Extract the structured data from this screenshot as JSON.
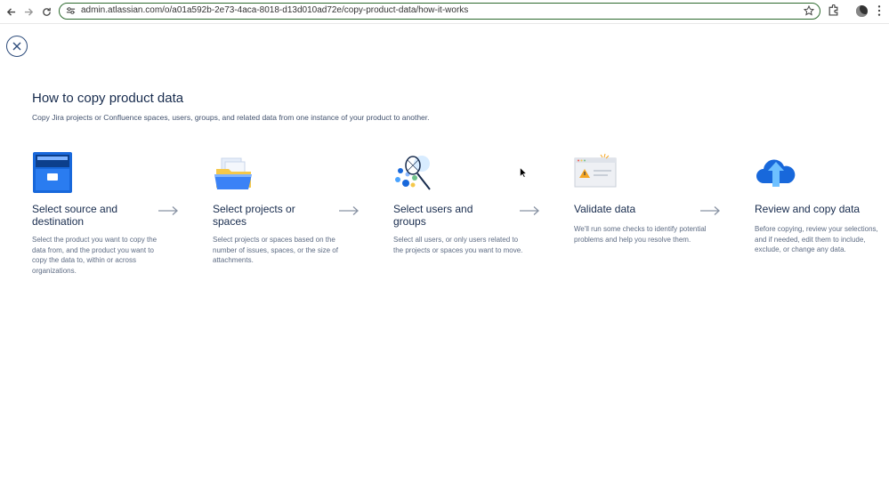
{
  "browser": {
    "url": "admin.atlassian.com/o/a01a592b-2e73-4aca-8018-d13d010ad72e/copy-product-data/how-it-works"
  },
  "page": {
    "title": "How to copy product data",
    "subtitle": "Copy Jira projects or Confluence spaces, users, groups, and related data from one instance of your product to another."
  },
  "steps": [
    {
      "title_line1": "Select source and",
      "title_line2": "destination",
      "description": "Select the product you want to copy the data from, and the product you want to copy the data to, within or across organizations."
    },
    {
      "title_line1": "Select projects or",
      "title_line2": "spaces",
      "description": "Select projects or spaces based on the number of issues, spaces, or the size of attachments."
    },
    {
      "title_line1": "Select users and",
      "title_line2": "groups",
      "description": "Select all users, or only users related to the projects or spaces you want to move."
    },
    {
      "title_line1": "Validate data",
      "title_line2": "",
      "description": "We'll run some checks to identify potential problems and help you resolve them."
    },
    {
      "title_line1": "Review and copy data",
      "title_line2": "",
      "description": "Before copying, review your selections, and if needed, edit them to include, exclude, or change any data."
    }
  ],
  "icons": {
    "step1": "file-cabinet-icon",
    "step2": "folders-icon",
    "step3": "users-net-icon",
    "step4": "warning-window-icon",
    "step5": "cloud-upload-icon"
  },
  "colors": {
    "heading": "#172b4d",
    "body_text": "#5e6c84",
    "accent_blue": "#1868db"
  }
}
